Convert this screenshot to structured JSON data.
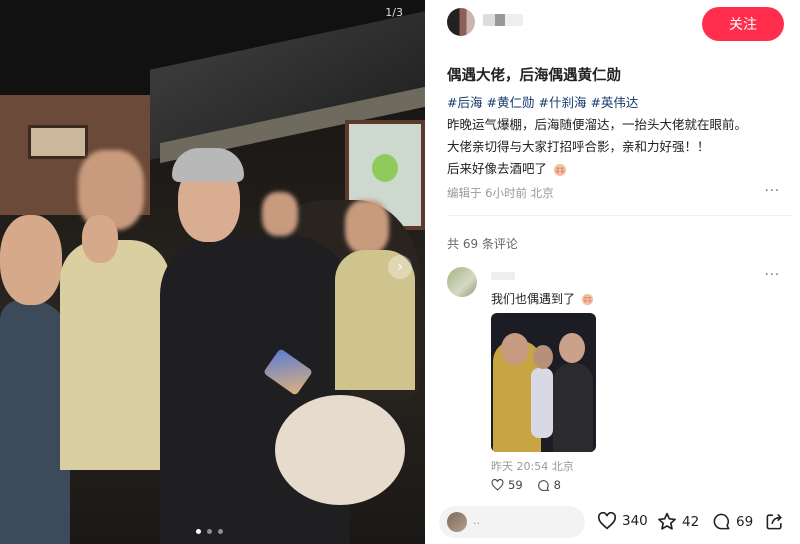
{
  "photo": {
    "page_counter": "1/3",
    "next_arrow": "›",
    "dots_count": 3,
    "active_dot": 0
  },
  "header": {
    "follow_label": "关注"
  },
  "post": {
    "title": "偶遇大佬，后海偶遇黄仁勋",
    "tags": [
      "#后海",
      "#黄仁勋",
      "#什刹海",
      "#英伟达"
    ],
    "lines": [
      "昨晚运气爆棚，后海随便溜达，一抬头大佬就在眼前。",
      "大佬亲切得与大家打招呼合影，亲和力好强！！",
      "后来好像去酒吧了"
    ],
    "meta": "编辑于 6小时前 北京",
    "more": "···"
  },
  "comments": {
    "count_label": "共 69 条评论",
    "items": [
      {
        "text": "我们也偶遇到了",
        "time": "昨天 20:54 北京",
        "likes": "59",
        "replies": "8",
        "more": "···"
      }
    ]
  },
  "bottom_bar": {
    "input_placeholder": "..",
    "likes": "340",
    "favorites": "42",
    "comments": "69"
  },
  "colors": {
    "accent": "#ff2e4d",
    "tag": "#13386c"
  },
  "icons": {
    "like": "heart-icon",
    "favorite": "star-icon",
    "comment": "comment-bubble-icon",
    "share": "share-icon",
    "emoji": "blush-emoji-icon"
  }
}
